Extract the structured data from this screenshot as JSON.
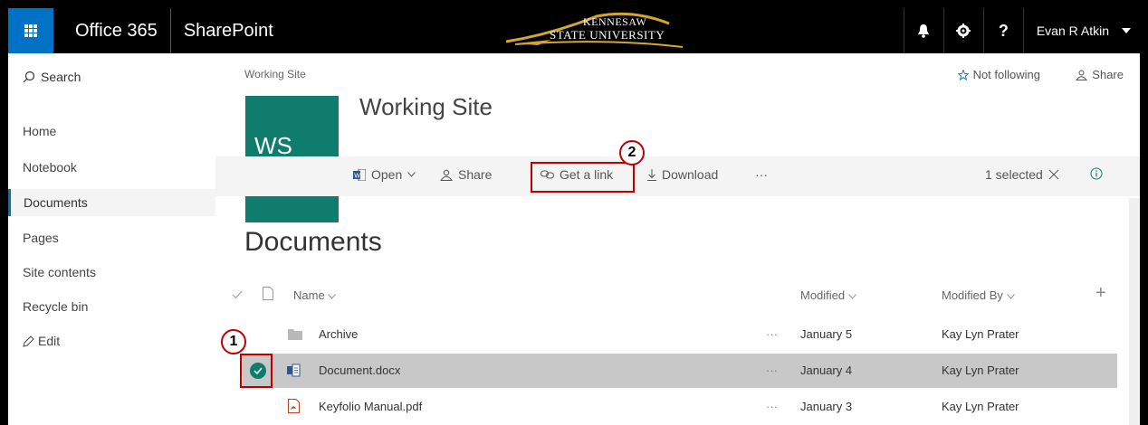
{
  "suite": {
    "app_name": "Office 365",
    "site_name": "SharePoint",
    "logo_line1": "KENNESAW",
    "logo_line2": "STATE UNIVERSITY",
    "user_name": "Evan R Atkin",
    "help_glyph": "?"
  },
  "leftnav": {
    "search_label": "Search",
    "items": [
      {
        "label": "Home"
      },
      {
        "label": "Notebook"
      },
      {
        "label": "Documents"
      },
      {
        "label": "Pages"
      },
      {
        "label": "Site contents"
      },
      {
        "label": "Recycle bin"
      },
      {
        "label": "Edit"
      }
    ],
    "selected": "Documents"
  },
  "header": {
    "breadcrumb": "Working Site",
    "follow_label": "Not following",
    "share_label": "Share",
    "site_initials": "WS",
    "site_title": "Working Site"
  },
  "commandbar": {
    "open_label": "Open",
    "share_label": "Share",
    "getlink_label": "Get a link",
    "download_label": "Download",
    "more_label": "···",
    "selected_label": "1 selected"
  },
  "library": {
    "title": "Documents",
    "columns": {
      "name": "Name",
      "modified": "Modified",
      "modified_by": "Modified By",
      "add": "+"
    },
    "rows": [
      {
        "name": "Archive",
        "type": "folder",
        "more": "···",
        "modified": "January 5",
        "modified_by": "Kay Lyn Prater",
        "selected": false
      },
      {
        "name": "Document.docx",
        "type": "word",
        "more": "···",
        "modified": "January 4",
        "modified_by": "Kay Lyn Prater",
        "selected": true
      },
      {
        "name": "Keyfolio Manual.pdf",
        "type": "pdf",
        "more": "···",
        "modified": "January 3",
        "modified_by": "Kay Lyn Prater",
        "selected": false
      }
    ]
  },
  "callouts": {
    "one": "1",
    "two": "2"
  },
  "colors": {
    "accent": "#0072c6",
    "site_tile": "#107c6e",
    "callout": "#c00000"
  }
}
